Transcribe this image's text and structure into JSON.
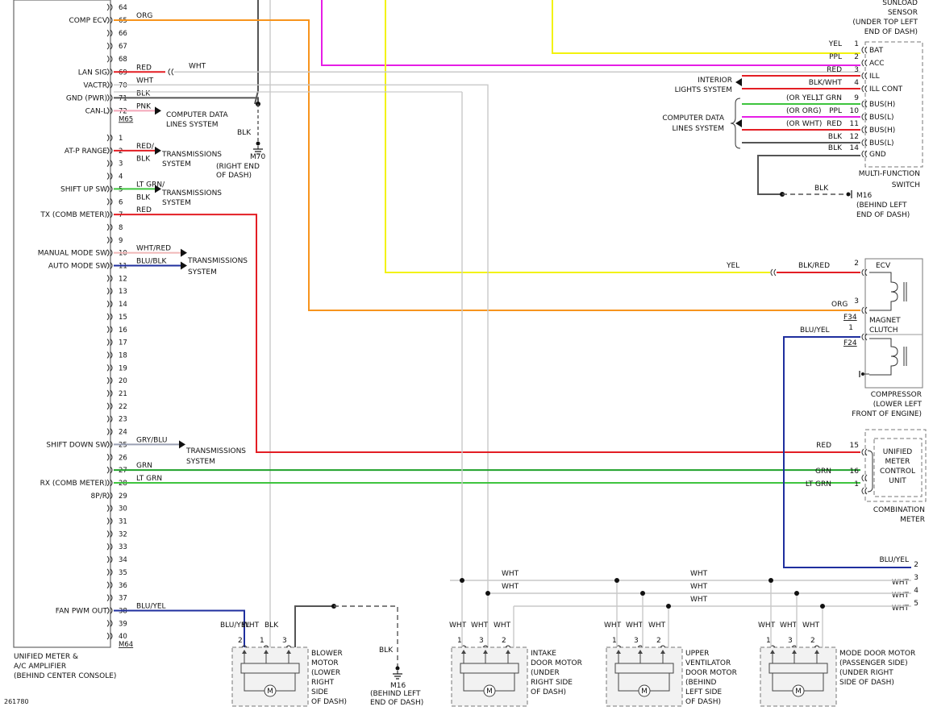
{
  "figure_id": "261780",
  "colors": {
    "ORG": "#f7941d",
    "RED": "#e31e24",
    "WHT": "#c9c9c9",
    "BLK": "#555555",
    "PNK": "#f4a7b9",
    "LTGRN": "#3ec43e",
    "GRN": "#1fa02a",
    "BLU": "#1f2f9e",
    "YEL": "#f2f20d",
    "PPL": "#e61ee6",
    "GRY": "#9aa0b4",
    "WHTRED": "#f0b6b6"
  },
  "amplifier": {
    "title": [
      "UNIFIED METER &",
      "A/C AMPLIFIER",
      "(BEHIND CENTER CONSOLE)"
    ],
    "connector_top": "M65",
    "connector_bottom": "M64",
    "pins_top": [
      64,
      65,
      66,
      67,
      68,
      69,
      70,
      71,
      72
    ],
    "pins_bottom": [
      1,
      2,
      3,
      4,
      5,
      6,
      7,
      8,
      9,
      10,
      11,
      12,
      13,
      14,
      15,
      16,
      17,
      18,
      19,
      20,
      21,
      22,
      23,
      24,
      25,
      26,
      27,
      28,
      29,
      30,
      31,
      32,
      33,
      34,
      35,
      36,
      37,
      38,
      39,
      40
    ],
    "side_labels": [
      {
        "pin": 65,
        "label": "COMP ECV"
      },
      {
        "pin": 69,
        "label": "LAN SIG"
      },
      {
        "pin": 70,
        "label": "VACTR"
      },
      {
        "pin": 71,
        "label": "GND (PWR)"
      },
      {
        "pin": 72,
        "label": "CAN-L"
      },
      {
        "pin": 2,
        "label": "AT-P RANGE"
      },
      {
        "pin": 5,
        "label": "SHIFT UP SW"
      },
      {
        "pin": 7,
        "label": "TX (COMB METER)"
      },
      {
        "pin": 10,
        "label": "MANUAL MODE SW"
      },
      {
        "pin": 11,
        "label": "AUTO MODE SW"
      },
      {
        "pin": 25,
        "label": "SHIFT DOWN SW"
      },
      {
        "pin": 28,
        "label": "RX (COMB METER)"
      },
      {
        "pin": 29,
        "label": "8P/R"
      },
      {
        "pin": 38,
        "label": "FAN PWM OUT"
      }
    ],
    "wire_labels": [
      {
        "pin": 65,
        "text": "ORG"
      },
      {
        "pin": 69,
        "text": "RED"
      },
      {
        "pin": 70,
        "text": "WHT"
      },
      {
        "pin": 71,
        "text": "BLK"
      },
      {
        "pin": 72,
        "text": "PNK"
      },
      {
        "pin": 2,
        "text": "RED/"
      },
      {
        "pin": 3,
        "text": "BLK"
      },
      {
        "pin": 5,
        "text": "LT GRN/"
      },
      {
        "pin": 6,
        "text": "BLK"
      },
      {
        "pin": 7,
        "text": "RED"
      },
      {
        "pin": 10,
        "text": "WHT/RED"
      },
      {
        "pin": 11,
        "text": "BLU/BLK"
      },
      {
        "pin": 25,
        "text": "GRY/BLU"
      },
      {
        "pin": 27,
        "text": "GRN"
      },
      {
        "pin": 28,
        "text": "LT GRN"
      },
      {
        "pin": 38,
        "text": "BLU/YEL"
      }
    ]
  },
  "references": {
    "computer_data": [
      "COMPUTER DATA",
      "LINES SYSTEM"
    ],
    "transmissions": [
      "TRANSMISSIONS",
      "SYSTEM"
    ],
    "interior_lights": [
      "INTERIOR",
      "LIGHTS SYSTEM"
    ]
  },
  "grounds": {
    "m70": {
      "wire": "BLK",
      "name": "M70",
      "loc": [
        "(RIGHT END",
        "OF DASH)"
      ]
    },
    "m16_top": {
      "wire": "BLK",
      "name": "M16",
      "loc": [
        "(BEHIND LEFT",
        "END OF DASH)"
      ]
    },
    "m16_bottom": {
      "wire": "BLK",
      "name": "M16",
      "loc": [
        "(BEHIND LEFT",
        "END OF DASH)"
      ]
    }
  },
  "sunload_sensor": {
    "lines": [
      "SUNLOAD",
      "SENSOR",
      "(UNDER TOP LEFT",
      "END OF DASH)"
    ]
  },
  "multi_function_switch": {
    "title": [
      "MULTI-FUNCTION",
      "SWITCH"
    ],
    "pins": [
      {
        "num": "1",
        "name": "BAT",
        "wire": "YEL"
      },
      {
        "num": "2",
        "name": "ACC",
        "wire": "PPL"
      },
      {
        "num": "3",
        "name": "ILL",
        "wire": "RED"
      },
      {
        "num": "4",
        "name": "ILL CONT",
        "wire": "BLK/WHT"
      },
      {
        "num": "9",
        "name": "BUS(H)",
        "wire": "LT GRN",
        "alt": "(OR YEL)"
      },
      {
        "num": "10",
        "name": "BUS(L)",
        "wire": "PPL",
        "alt": "(OR ORG)"
      },
      {
        "num": "11",
        "name": "BUS(H)",
        "wire": "RED",
        "alt": "(OR WHT)"
      },
      {
        "num": "12",
        "name": "BUS(L)",
        "wire": "BLK"
      },
      {
        "num": "14",
        "name": "GND",
        "wire": "BLK"
      }
    ]
  },
  "compressor": {
    "ecv_label": "ECV",
    "clutch_label": [
      "MAGNET",
      "CLUTCH"
    ],
    "title": [
      "COMPRESSOR",
      "(LOWER LEFT",
      "FRONT OF ENGINE)"
    ],
    "conn_top": "F34",
    "conn_bottom": "F24",
    "yel_label": "YEL",
    "pin2_wire": "BLK/RED",
    "pin2": "2",
    "pin3_wire": "ORG",
    "pin3": "3",
    "pin1_wire": "BLU/YEL",
    "pin1": "1"
  },
  "combination_meter": {
    "inner": [
      "UNIFIED",
      "METER",
      "CONTROL",
      "UNIT"
    ],
    "title": [
      "COMBINATION",
      "METER"
    ],
    "pins": [
      {
        "num": "15",
        "wire": "RED"
      },
      {
        "num": "16",
        "wire": "GRN"
      },
      {
        "num": "1",
        "wire": "LT GRN"
      }
    ]
  },
  "motor_bus": {
    "pins": [
      {
        "num": "2",
        "wire": "BLU/YEL"
      },
      {
        "num": "3",
        "wire": "WHT"
      },
      {
        "num": "4",
        "wire": "WHT"
      },
      {
        "num": "5",
        "wire": "WHT"
      }
    ],
    "mid_labels": [
      "WHT",
      "WHT",
      "WHT",
      "WHT",
      "WHT"
    ]
  },
  "motors": [
    {
      "id": "blower",
      "label": [
        "BLOWER",
        "MOTOR",
        "(LOWER",
        "RIGHT",
        "SIDE",
        "OF DASH)"
      ],
      "pins": [
        "2",
        "1",
        "3"
      ],
      "wires": [
        "BLU/YEL",
        "WHT",
        "BLK"
      ]
    },
    {
      "id": "intake",
      "label": [
        "INTAKE",
        "DOOR MOTOR",
        "(UNDER",
        "RIGHT SIDE",
        "OF DASH)"
      ],
      "pins": [
        "1",
        "3",
        "2"
      ],
      "wires": [
        "WHT",
        "WHT",
        "WHT"
      ]
    },
    {
      "id": "upper-vent",
      "label": [
        "UPPER",
        "VENTILATOR",
        "DOOR MOTOR",
        "(BEHIND",
        "LEFT SIDE",
        "OF DASH)"
      ],
      "pins": [
        "1",
        "3",
        "2"
      ],
      "wires": [
        "WHT",
        "WHT",
        "WHT"
      ]
    },
    {
      "id": "mode-door",
      "label": [
        "MODE DOOR MOTOR",
        "(PASSENGER SIDE)",
        "(UNDER RIGHT",
        "SIDE OF DASH)"
      ],
      "pins": [
        "1",
        "3",
        "2"
      ],
      "wires": [
        "WHT",
        "WHT",
        "WHT"
      ]
    }
  ],
  "motor_symbol": "M"
}
